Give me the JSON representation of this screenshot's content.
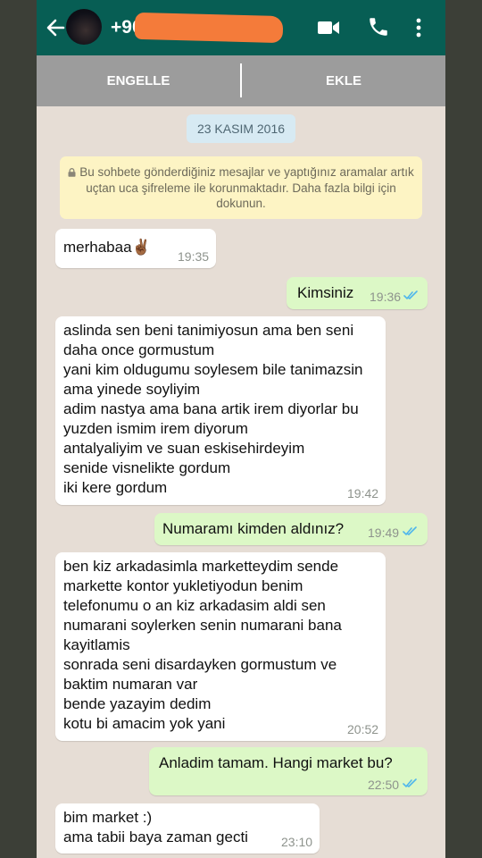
{
  "header": {
    "contact": "+90",
    "back_icon": "arrow-left-icon",
    "video_icon": "video-call-icon",
    "call_icon": "phone-icon",
    "menu_icon": "more-vert-icon"
  },
  "actions": {
    "block": "ENGELLE",
    "add": "EKLE"
  },
  "date_chip": "23 KASIM 2016",
  "encryption_notice": "Bu sohbete gönderdiğiniz mesajlar ve yaptığınız aramalar artık uçtan uca şifreleme ile korunmaktadır. Daha fazla bilgi için dokunun.",
  "messages": [
    {
      "dir": "in",
      "text": "merhabaa✌🏾",
      "time": "19:35"
    },
    {
      "dir": "out",
      "text": "Kimsiniz",
      "time": "19:36",
      "read": true
    },
    {
      "dir": "in",
      "text": "aslinda sen beni tanimiyosun ama ben seni daha once gormustum\nyani kim oldugumu soylesem bile tanimazsin ama yinede soyliyim\nadim nastya ama bana artik irem diyorlar bu yuzden ismim irem diyorum\nantalyaliyim ve suan eskisehirdeyim\nsenide visnelikte gordum\niki kere gordum",
      "time": "19:42"
    },
    {
      "dir": "out",
      "text": "Numaramı kimden aldınız?",
      "time": "19:49",
      "read": true
    },
    {
      "dir": "in",
      "text": "ben kiz arkadasimla marketteydim sende markette kontor yukletiyodun benim telefonumu o an kiz arkadasim aldi sen numarani soylerken senin numarani bana kayitlamis\nsonrada seni disardayken gormustum ve baktim numaran var\nbende yazayim dedim\nkotu bi amacim yok yani",
      "time": "20:52"
    },
    {
      "dir": "out",
      "text": "Anladim tamam. Hangi market bu?",
      "time": "22:50",
      "read": true
    },
    {
      "dir": "in",
      "text": "bim market :)\nama tabii baya zaman gecti",
      "time": "23:10"
    }
  ],
  "colors": {
    "appbar": "#075e54",
    "action_bar": "#9c9c9c",
    "chat_background": "#e6ddd5",
    "incoming_bubble": "#ffffff",
    "outgoing_bubble": "#dcf8c6",
    "read_ticks": "#4fb6ec",
    "redaction": "#f47b3a"
  }
}
